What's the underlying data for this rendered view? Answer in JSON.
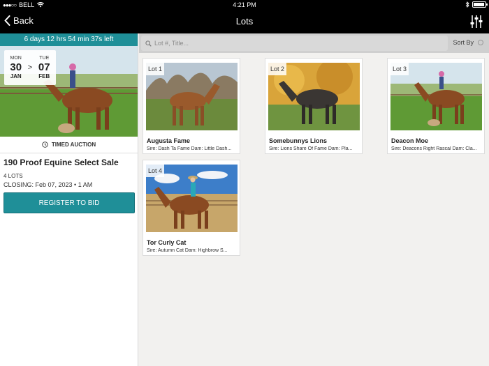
{
  "status_bar": {
    "carrier": "BELL",
    "time": "4:21 PM"
  },
  "nav": {
    "back_label": "Back",
    "title": "Lots"
  },
  "auction": {
    "countdown": "6 days 12 hrs 54 min 37s left",
    "start": {
      "dow": "MON",
      "day": "30",
      "month": "JAN"
    },
    "end": {
      "dow": "TUE",
      "day": "07",
      "month": "FEB"
    },
    "date_separator": ">",
    "type": "TIMED AUCTION",
    "title": "190 Proof Equine Select Sale",
    "lots_count": "4 LOTS",
    "closing": "CLOSING: Feb 07, 2023 • 1 AM",
    "register_label": "REGISTER TO BID"
  },
  "search": {
    "placeholder": "Lot #, Title...",
    "sort_label": "Sort By"
  },
  "lots": [
    {
      "badge": "Lot 1",
      "name": "Augusta Fame",
      "sire": "Sire: Dash Ta Fame Dam: Little Dash..."
    },
    {
      "badge": "Lot 2",
      "name": "Somebunnys Lions",
      "sire": "Sire: Lions Share Of Fame Dam: Pla..."
    },
    {
      "badge": "Lot 3",
      "name": "Deacon Moe",
      "sire": "Sire: Deacons Right Rascal Dam: Cla..."
    },
    {
      "badge": "Lot 4",
      "name": "Tor Curly Cat",
      "sire": "Sire: Autumn Cat Dam: Highbrow S..."
    }
  ],
  "colors": {
    "accent": "#1f8f98",
    "nav_bg": "#000000"
  },
  "icons": {
    "back": "chevron-left-icon",
    "filter": "sliders-icon",
    "search": "magnifier-icon",
    "clock": "clock-icon",
    "wifi": "wifi-icon",
    "bluetooth": "bluetooth-icon",
    "battery": "battery-icon"
  }
}
